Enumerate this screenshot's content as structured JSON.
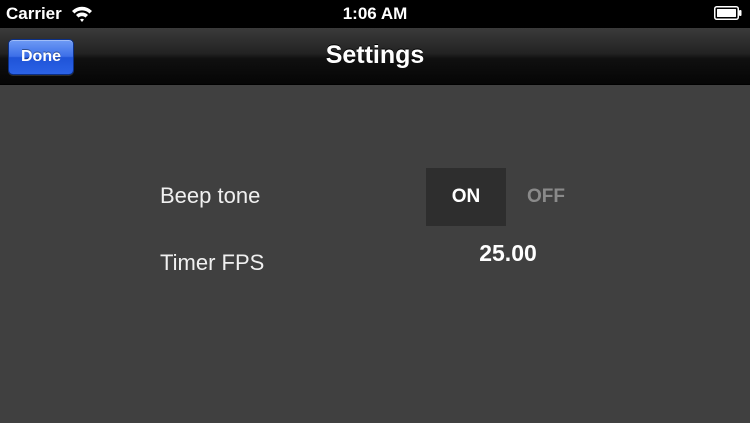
{
  "status_bar": {
    "carrier": "Carrier",
    "time": "1:06 AM",
    "icons": [
      "wifi-icon",
      "battery-icon"
    ]
  },
  "nav_bar": {
    "title": "Settings",
    "done_label": "Done"
  },
  "settings": {
    "beep_tone": {
      "label": "Beep tone",
      "on_label": "ON",
      "off_label": "OFF",
      "selected": "ON"
    },
    "timer_fps": {
      "label": "Timer FPS",
      "value": "25.00"
    }
  },
  "colors": {
    "background": "#404040",
    "done_button": "#2b62e6",
    "toggle_selected_bg": "#2e2e2e",
    "toggle_unselected_text": "#8a8a8a"
  }
}
